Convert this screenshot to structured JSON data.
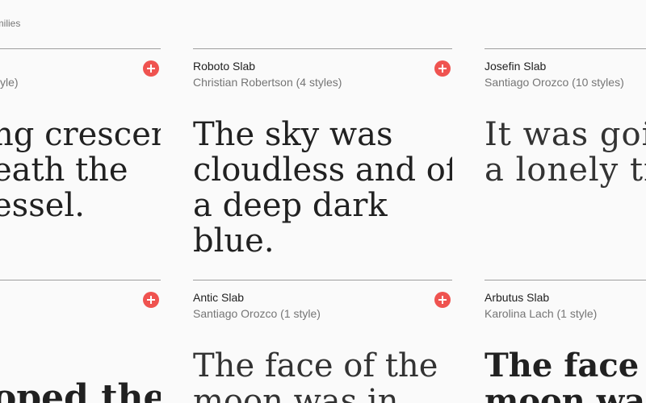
{
  "header": {
    "families_label": "amilies"
  },
  "colors": {
    "accent": "#ef5350",
    "divider": "#9e9e9e",
    "meta_text": "#757575"
  },
  "cards": {
    "left_top": {
      "name": "",
      "meta": "yle)",
      "sample": "ng crescent\neath the\nessel."
    },
    "roboto_slab": {
      "name": "Roboto Slab",
      "meta": "Christian Robertson (4 styles)",
      "sample": "The sky was\ncloudless and of\na deep dark blue."
    },
    "josefin_slab": {
      "name": "Josefin Slab",
      "meta": "Santiago Orozco (10 styles)",
      "sample": "It was going\na lonely trip"
    },
    "left_bottom": {
      "name": "",
      "meta": "",
      "sample": "oped the"
    },
    "antic_slab": {
      "name": "Antic Slab",
      "meta": "Santiago Orozco (1 style)",
      "sample": "The face of the\nmoon was in"
    },
    "arbutus_slab": {
      "name": "Arbutus Slab",
      "meta": "Karolina Lach (1 style)",
      "sample": "The face o\nmoon wa"
    }
  },
  "icons": {
    "add": "plus-circle-icon"
  }
}
